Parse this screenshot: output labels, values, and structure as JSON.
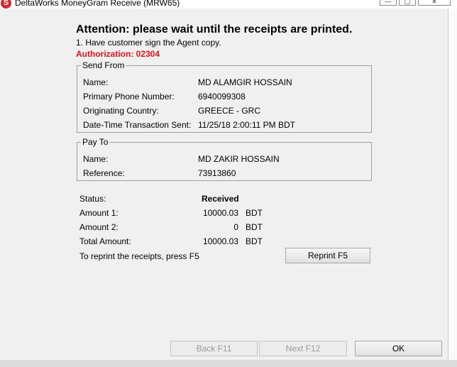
{
  "window": {
    "title": "DeltaWorks MoneyGram Receive   (MRW65)",
    "icon_glyph": "S",
    "min_glyph": "—",
    "max_glyph": "▢",
    "close_glyph": "✕"
  },
  "header": {
    "attention": "Attention: please wait until the receipts are printed.",
    "instruction": "1.  Have customer sign the Agent copy.",
    "authorization": "Authorization: 02304"
  },
  "send_from": {
    "legend": "Send From",
    "rows": [
      {
        "label": "Name:",
        "value": "MD ALAMGIR HOSSAIN"
      },
      {
        "label": "Primary Phone Number:",
        "value": "6940099308"
      },
      {
        "label": "Originating Country:",
        "value": "GREECE - GRC"
      },
      {
        "label": "Date-Time Transaction Sent:",
        "value": "11/25/18 2:00:11 PM BDT"
      }
    ]
  },
  "pay_to": {
    "legend": "Pay To",
    "rows": [
      {
        "label": "Name:",
        "value": "MD ZAKIR HOSSAIN"
      },
      {
        "label": "Reference:",
        "value": "73913860"
      }
    ]
  },
  "summary": {
    "status_label": "Status:",
    "status_value": "Received",
    "rows": [
      {
        "label": "Amount 1:",
        "value": "10000.03",
        "currency": "BDT"
      },
      {
        "label": "Amount 2:",
        "value": "0",
        "currency": "BDT"
      },
      {
        "label": "Total Amount:",
        "value": "10000.03",
        "currency": "BDT"
      }
    ],
    "reprint_hint": "To reprint the receipts, press F5"
  },
  "buttons": {
    "reprint": "Reprint F5",
    "back": "Back  F11",
    "next": "Next  F12",
    "ok": "OK"
  },
  "colors": {
    "authorization": "#e0141e",
    "background": "#f0f0f0"
  }
}
